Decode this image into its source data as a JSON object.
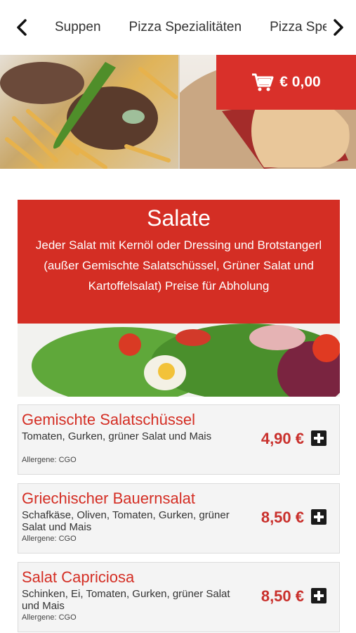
{
  "nav": {
    "tabs": [
      {
        "label": "Suppen"
      },
      {
        "label": "Pizza Spezialitäten"
      },
      {
        "label": "Pizza Spezial"
      }
    ]
  },
  "cart": {
    "total": "€ 0,00"
  },
  "category": {
    "title": "Salate",
    "description": "Jeder Salat mit Kernöl oder Dressing und Brotstangerl (außer Gemischte Salatschüssel, Grüner Salat und Kartoffelsalat) Preise für Abholung"
  },
  "items": [
    {
      "name": "Gemischte Salatschüssel",
      "description": "Tomaten, Gurken, grüner Salat und Mais",
      "allergens": "Allergene: CGO",
      "price": "4,90 €"
    },
    {
      "name": "Griechischer Bauernsalat",
      "description": "Schafkäse, Oliven, Tomaten, Gurken, grüner Salat und Mais",
      "allergens": "Allergene: CGO",
      "price": "8,50 €"
    },
    {
      "name": "Salat Capriciosa",
      "description": "Schinken, Ei, Tomaten, Gurken, grüner Salat und Mais",
      "allergens": "Allergene: CGO",
      "price": "8,50 €"
    }
  ],
  "colors": {
    "accent": "#d42e24",
    "price": "#c9302c"
  },
  "icons": {
    "prev": "chevron-left-icon",
    "next": "chevron-right-icon",
    "cart": "cart-icon",
    "add": "plus-icon"
  }
}
